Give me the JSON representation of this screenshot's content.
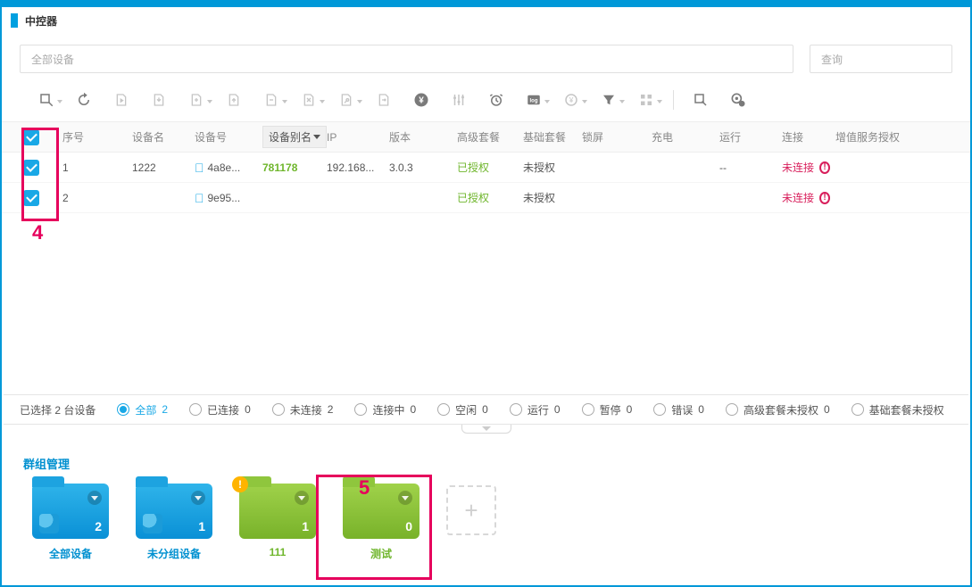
{
  "header": {
    "title": "中控器"
  },
  "search": {
    "placeholder": "全部设备",
    "query_placeholder": "查询"
  },
  "columns": {
    "seq": "序号",
    "name": "设备名",
    "num": "设备号",
    "alias": "设备别名",
    "ip": "IP",
    "ver": "版本",
    "pkg": "高级套餐",
    "base": "基础套餐",
    "lock": "锁屏",
    "charge": "充电",
    "run": "运行",
    "conn": "连接",
    "svc": "增值服务授权"
  },
  "rows": [
    {
      "seq": "1",
      "name": "1222",
      "num": "4a8e...",
      "alias": "781178",
      "ip": "192.168...",
      "ver": "3.0.3",
      "pkg": "已授权",
      "base": "未授权",
      "lock": "",
      "charge": "",
      "run": "--",
      "conn": "未连接"
    },
    {
      "seq": "2",
      "name": "",
      "num": "9e95...",
      "alias": "",
      "ip": "",
      "ver": "",
      "pkg": "已授权",
      "base": "未授权",
      "lock": "",
      "charge": "",
      "run": "",
      "conn": "未连接"
    }
  ],
  "status": {
    "selected": "已选择 2 台设备",
    "filters": [
      {
        "label": "全部",
        "count": "2",
        "sel": true
      },
      {
        "label": "已连接",
        "count": "0",
        "sel": false
      },
      {
        "label": "未连接",
        "count": "2",
        "sel": false
      },
      {
        "label": "连接中",
        "count": "0",
        "sel": false
      },
      {
        "label": "空闲",
        "count": "0",
        "sel": false
      },
      {
        "label": "运行",
        "count": "0",
        "sel": false
      },
      {
        "label": "暂停",
        "count": "0",
        "sel": false
      },
      {
        "label": "错误",
        "count": "0",
        "sel": false
      },
      {
        "label": "高级套餐未授权",
        "count": "0",
        "sel": false
      },
      {
        "label": "基础套餐未授权",
        "count": "",
        "sel": false
      }
    ]
  },
  "groups": {
    "title": "群组管理",
    "items": [
      {
        "count": "2",
        "label": "全部设备",
        "color": "blue"
      },
      {
        "count": "1",
        "label": "未分组设备",
        "color": "blue"
      },
      {
        "count": "1",
        "label": "111",
        "color": "green",
        "warn": true
      },
      {
        "count": "0",
        "label": "测试",
        "color": "green"
      }
    ]
  },
  "annotations": {
    "a4": "4",
    "a5": "5"
  }
}
